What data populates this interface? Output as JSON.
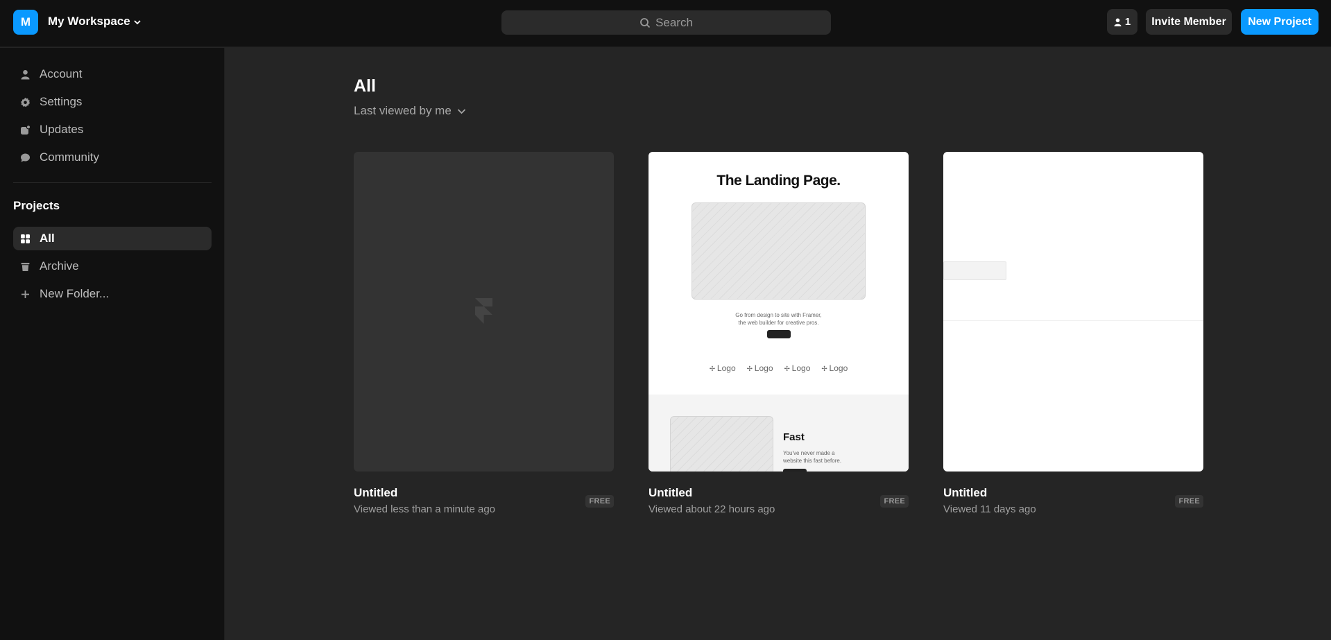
{
  "workspace": {
    "avatar_initial": "M",
    "name": "My Workspace"
  },
  "search": {
    "label": "Search"
  },
  "header": {
    "member_count": "1",
    "invite_label": "Invite Member",
    "new_project_label": "New Project"
  },
  "sidebar": {
    "items": [
      {
        "label": "Account",
        "icon": "user-icon"
      },
      {
        "label": "Settings",
        "icon": "gear-icon"
      },
      {
        "label": "Updates",
        "icon": "updates-icon"
      },
      {
        "label": "Community",
        "icon": "chat-bubble-icon"
      }
    ],
    "projects_title": "Projects",
    "project_items": [
      {
        "label": "All",
        "icon": "grid-icon",
        "active": true
      },
      {
        "label": "Archive",
        "icon": "trash-icon"
      },
      {
        "label": "New Folder...",
        "icon": "plus-icon"
      }
    ]
  },
  "main": {
    "title": "All",
    "sort_label": "Last viewed by me",
    "projects": [
      {
        "name": "Untitled",
        "meta": "Viewed less than a minute ago",
        "badge": "FREE"
      },
      {
        "name": "Untitled",
        "meta": "Viewed about 22 hours ago",
        "badge": "FREE",
        "preview": {
          "title": "The Landing Page.",
          "subtitle_line1": "Go from design to site with Framer,",
          "subtitle_line2": "the web builder for creative pros.",
          "logos": [
            "Logo",
            "Logo",
            "Logo",
            "Logo"
          ],
          "feature_title": "Fast",
          "feature_line1": "You've never made a",
          "feature_line2": "website this fast before."
        }
      },
      {
        "name": "Untitled",
        "meta": "Viewed 11 days ago",
        "badge": "FREE"
      }
    ]
  },
  "colors": {
    "accent": "#0a99ff",
    "topbar": "#111111",
    "main_bg": "#252525",
    "card_dark": "#333333"
  }
}
